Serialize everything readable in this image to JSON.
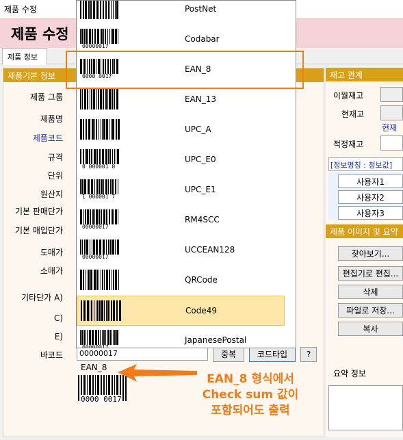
{
  "window_title": "제품 수정",
  "header_title": "제품 수정",
  "tab_label": "제품 정보",
  "left_section_title": "제품기본 정보",
  "fields": {
    "group": "제품 그룹",
    "name": "제품명",
    "code": "제품코드",
    "spec": "규격",
    "unit": "단위",
    "origin": "원산지",
    "base_sale": "기본 판매단가",
    "base_buy": "기본 매입단가",
    "wholesale": "도매가",
    "retail": "소매가",
    "other_a": "기타단가  A)",
    "other_c": "C)",
    "other_e": "E)",
    "barcode": "바코드"
  },
  "barcode_value": "00000017",
  "buttons": {
    "register": "중복",
    "code_type": "코드타입",
    "help": "?"
  },
  "barcode_type_label": "EAN_8",
  "barcode_preview_digits": "0000 0017",
  "right": {
    "stock_title": "재고 관계",
    "last_month": "이월재고",
    "current": "현재고",
    "current_link": "현재고",
    "proper": "적정재고",
    "info_header": "[정보명칭 : 정보값]",
    "users": [
      "사용자1",
      "사용자2",
      "사용자3"
    ],
    "image_title": "제품 이미지 및 요약",
    "image_buttons": [
      "찾아보기...",
      "편집기로 편집...",
      "삭제",
      "파일로 저장...",
      "복사"
    ],
    "summary_label": "요약 정보"
  },
  "dropdown": {
    "items": [
      {
        "label": "PostNet",
        "digits": ""
      },
      {
        "label": "Codabar",
        "digits": "00000017"
      },
      {
        "label": "EAN_8",
        "digits": "0000 0017"
      },
      {
        "label": "EAN_13",
        "digits": ""
      },
      {
        "label": "UPC_A",
        "digits": ""
      },
      {
        "label": "UPC_E0",
        "digits": "0 000001 0"
      },
      {
        "label": "UPC_E1",
        "digits": "1 000001 7"
      },
      {
        "label": "RM4SCC",
        "digits": "00000017"
      },
      {
        "label": "UCCEAN128",
        "digits": "00000017"
      },
      {
        "label": "QRCode",
        "digits": ""
      },
      {
        "label": "Code49",
        "digits": ""
      },
      {
        "label": "JapanesePostal",
        "digits": "00000017"
      }
    ],
    "selected_index": 10
  },
  "annotation_lines": [
    "EAN_8 형식에서",
    "Check sum 값이",
    "포함되어도 출력"
  ],
  "colors": {
    "accent_orange": "#f07d1a",
    "section_gold": "#d99f16",
    "header_pink": "#f6d3d8",
    "selected_yellow": "#fde8a9"
  }
}
